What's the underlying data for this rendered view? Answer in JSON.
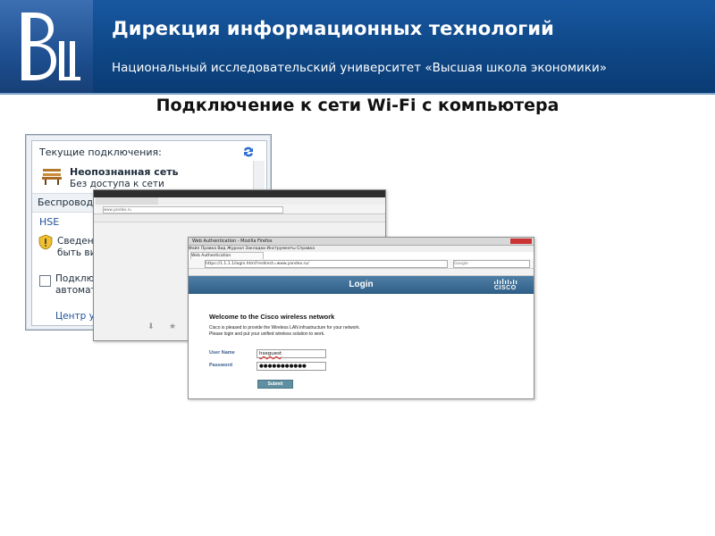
{
  "header": {
    "title": "Дирекция информационных технологий",
    "subtitle": "Национальный исследовательский университет «Высшая школа экономики»"
  },
  "slide": {
    "title": "Подключение к сети Wi-Fi с компьютера"
  },
  "network_panel": {
    "current_connections_label": "Текущие подключения:",
    "network_name": "Неопознанная сеть",
    "network_status": "Без доступа к сети",
    "wireless_section": "Беспроводно",
    "ssid": "HSE",
    "info_text_line1": "Сведения",
    "info_text_line2": "быть вид",
    "auto_connect_line1": "Подключ",
    "auto_connect_line2": "автоматич",
    "network_center_link": "Центр упр"
  },
  "browser1": {
    "url": "www.yandex.ru"
  },
  "browser2": {
    "window_title": "Web Authentication - Mozilla Firefox",
    "menu": "Файл  Правка  Вид  Журнал  Закладки  Инструменты  Справка",
    "tab_title": "Web Authentication",
    "url": "https://1.1.1.1/login.html?redirect=www.yandex.ru/",
    "search_placeholder": "Google",
    "banner_title": "Login",
    "brand": "CISCO",
    "welcome": "Welcome to the Cisco wireless network",
    "description": "Cisco is pleased to provide the Wireless LAN infrastructure for your network. Please login and put your unified wireless solution to work.",
    "username_label": "User Name",
    "username_value": "hseguest",
    "password_label": "Password",
    "password_value": "●●●●●●●●●●●",
    "submit_label": "Submit"
  },
  "colors": {
    "header_bg": "#0e4786",
    "cisco_banner": "#2f5f86",
    "link": "#1f4f9a"
  }
}
